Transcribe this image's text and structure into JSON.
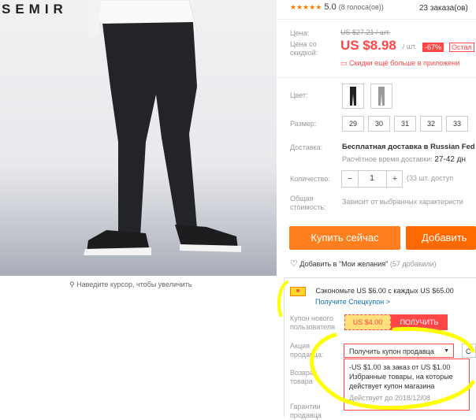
{
  "brand": {
    "logo_text": "SEMIR"
  },
  "image": {
    "zoom_hint": "Наведите курсор, чтобы увеличить"
  },
  "rating": {
    "stars": "★★★★★",
    "score": "5.0",
    "votes": "(8 голоса(ов))",
    "orders": "23 заказа(ов)"
  },
  "price": {
    "label": "Цена:",
    "old": "US $27.21 / шт.",
    "discount_label_line1": "Цена со",
    "discount_label_line2": "скидкой:",
    "new": "US $8.98",
    "unit": "/ шт.",
    "discount_pct": "-67%",
    "remaining": "Остал",
    "app_promo": "Скидки ещё больше в приложени"
  },
  "color": {
    "label": "Цвет:"
  },
  "size": {
    "label": "Размер:",
    "options": [
      "29",
      "30",
      "31",
      "32",
      "33"
    ]
  },
  "shipping": {
    "label": "Доставка:",
    "value": "Бесплатная доставка в Russian Fed",
    "eta": "Расчётное время доставки:",
    "eta_days": "27-42 дн"
  },
  "quantity": {
    "label": "Количество:",
    "minus": "−",
    "value": "1",
    "plus": "+",
    "available": "(33 шт. доступ"
  },
  "total": {
    "label_line1": "Общая",
    "label_line2": "стоимость:",
    "value": "Зависит от выбранных характеристи"
  },
  "actions": {
    "buy_now": "Купить сейчас",
    "add_to_cart": "Добавить",
    "wishlist": "Добавить в \"Мои желания\"",
    "wishlist_count": "(57 добавили)"
  },
  "promo": {
    "savings": "Сэкономьте US $6.00 с каждых US $65.00",
    "get_coupon": "Получите Спецкупон >",
    "new_user_label_line1": "Купон нового",
    "new_user_label_line2": "пользователя",
    "coupon_value": "US $4.00",
    "coupon_get": "ПОЛУЧИТЬ",
    "seller_label_line1": "Акция",
    "seller_label_line2": "продавца:",
    "seller_select": "Получить купон продавца",
    "seller_c": "С",
    "return_label_line1": "Возврат",
    "return_label_line2": "товара",
    "coupon_detail_line1": "-US $1.00 за заказ от US $1.00",
    "coupon_detail_line2": "Избранные товары, на которые",
    "coupon_detail_line3": "действует купон магазина",
    "coupon_expiry": "Действует до 2018/12/08",
    "guarantee_line1": "Гарантии",
    "guarantee_line2": "продавца"
  },
  "colors": {
    "accent": "#ff4747",
    "orange": "#ff6a00",
    "highlight": "#ffff00",
    "link": "#0f6eb5"
  }
}
